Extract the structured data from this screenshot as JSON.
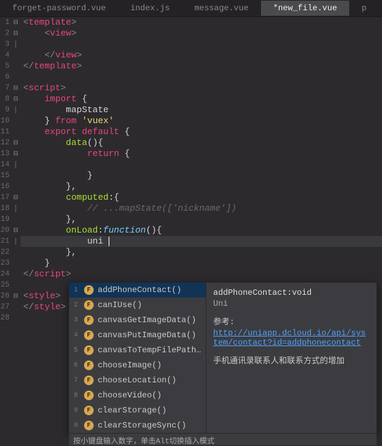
{
  "tabs": [
    {
      "label": "forget-password.vue",
      "active": false
    },
    {
      "label": "index.js",
      "active": false
    },
    {
      "label": "message.vue",
      "active": false
    },
    {
      "label": "*new_file.vue",
      "active": true
    },
    {
      "label": "p",
      "active": false
    }
  ],
  "code_lines": [
    {
      "n": 1,
      "fold": "▣",
      "tokens": [
        [
          "<",
          "p-gray"
        ],
        [
          "template",
          "p-red"
        ],
        [
          ">",
          "p-gray"
        ]
      ]
    },
    {
      "n": 2,
      "fold": "▣",
      "tokens": [
        [
          "    ",
          "p-gray"
        ],
        [
          "<",
          "p-gray"
        ],
        [
          "view",
          "p-red"
        ],
        [
          ">",
          "p-gray"
        ]
      ]
    },
    {
      "n": 3,
      "fold": "│",
      "tokens": [
        [
          "",
          "p-gray"
        ]
      ]
    },
    {
      "n": 4,
      "fold": "",
      "tokens": [
        [
          "    ",
          "p-gray"
        ],
        [
          "</",
          "p-gray"
        ],
        [
          "view",
          "p-red"
        ],
        [
          ">",
          "p-gray"
        ]
      ]
    },
    {
      "n": 5,
      "fold": "",
      "tokens": [
        [
          "</",
          "p-gray"
        ],
        [
          "template",
          "p-red"
        ],
        [
          ">",
          "p-gray"
        ]
      ]
    },
    {
      "n": 6,
      "fold": "",
      "tokens": [
        [
          "",
          "p-gray"
        ]
      ]
    },
    {
      "n": 7,
      "fold": "▣",
      "tokens": [
        [
          "<",
          "p-gray"
        ],
        [
          "script",
          "p-red"
        ],
        [
          ">",
          "p-gray"
        ]
      ]
    },
    {
      "n": 8,
      "fold": "▣",
      "tokens": [
        [
          "    ",
          "p-gray"
        ],
        [
          "import",
          "p-red"
        ],
        [
          " {",
          "p-white"
        ]
      ]
    },
    {
      "n": 9,
      "fold": "│",
      "tokens": [
        [
          "        mapState",
          "p-white"
        ]
      ]
    },
    {
      "n": 10,
      "fold": "",
      "tokens": [
        [
          "    } ",
          "p-white"
        ],
        [
          "from",
          "p-red"
        ],
        [
          " ",
          "p-white"
        ],
        [
          "'vuex'",
          "p-yellow"
        ]
      ]
    },
    {
      "n": 11,
      "fold": "",
      "tokens": [
        [
          "    ",
          "p-white"
        ],
        [
          "export",
          "p-red"
        ],
        [
          " ",
          "p-white"
        ],
        [
          "default",
          "p-red"
        ],
        [
          " {",
          "p-white"
        ]
      ]
    },
    {
      "n": 12,
      "fold": "▣",
      "tokens": [
        [
          "        ",
          "p-white"
        ],
        [
          "data",
          "p-green"
        ],
        [
          "(){",
          "p-white"
        ]
      ]
    },
    {
      "n": 13,
      "fold": "▣",
      "tokens": [
        [
          "            ",
          "p-white"
        ],
        [
          "return",
          "p-red"
        ],
        [
          " {",
          "p-white"
        ]
      ]
    },
    {
      "n": 14,
      "fold": "│",
      "tokens": [
        [
          "",
          "p-white"
        ]
      ]
    },
    {
      "n": 15,
      "fold": "",
      "tokens": [
        [
          "            }",
          "p-white"
        ]
      ]
    },
    {
      "n": 16,
      "fold": "",
      "tokens": [
        [
          "        },",
          "p-white"
        ]
      ]
    },
    {
      "n": 17,
      "fold": "▣",
      "tokens": [
        [
          "        ",
          "p-white"
        ],
        [
          "computed",
          "p-green"
        ],
        [
          ":{",
          "p-white"
        ]
      ]
    },
    {
      "n": 18,
      "fold": "│",
      "tokens": [
        [
          "            ",
          "p-white"
        ],
        [
          "// ...mapState(['nickname'])",
          "p-comment"
        ]
      ]
    },
    {
      "n": 19,
      "fold": "",
      "tokens": [
        [
          "        },",
          "p-white"
        ]
      ]
    },
    {
      "n": 20,
      "fold": "▣",
      "tokens": [
        [
          "        ",
          "p-white"
        ],
        [
          "onLoad",
          "p-green"
        ],
        [
          ":",
          "p-white"
        ],
        [
          "function",
          "p-blue p-italic"
        ],
        [
          "(){",
          "p-white"
        ]
      ]
    },
    {
      "n": 21,
      "fold": "│",
      "tokens": [
        [
          "            uni ",
          "p-white"
        ]
      ],
      "cursor": true
    },
    {
      "n": 22,
      "fold": "",
      "tokens": [
        [
          "        },",
          "p-white"
        ]
      ]
    },
    {
      "n": 23,
      "fold": "",
      "tokens": [
        [
          "    }",
          "p-white"
        ]
      ]
    },
    {
      "n": 24,
      "fold": "",
      "tokens": [
        [
          "</",
          "p-gray"
        ],
        [
          "script",
          "p-red"
        ],
        [
          ">",
          "p-gray"
        ]
      ]
    },
    {
      "n": 25,
      "fold": "",
      "tokens": [
        [
          "",
          "p-gray"
        ]
      ]
    },
    {
      "n": 26,
      "fold": "▣",
      "tokens": [
        [
          "<",
          "p-gray"
        ],
        [
          "style",
          "p-red"
        ],
        [
          ">",
          "p-gray"
        ]
      ]
    },
    {
      "n": 27,
      "fold": "",
      "tokens": [
        [
          "</",
          "p-gray"
        ],
        [
          "style",
          "p-red"
        ],
        [
          ">",
          "p-gray"
        ]
      ]
    },
    {
      "n": 28,
      "fold": "",
      "tokens": [
        [
          "",
          "p-gray"
        ]
      ]
    }
  ],
  "autocomplete": {
    "items": [
      {
        "idx": "1",
        "label": "addPhoneContact()",
        "selected": true
      },
      {
        "idx": "2",
        "label": "canIUse()"
      },
      {
        "idx": "3",
        "label": "canvasGetImageData()"
      },
      {
        "idx": "4",
        "label": "canvasPutImageData()"
      },
      {
        "idx": "5",
        "label": "canvasToTempFilePath…"
      },
      {
        "idx": "6",
        "label": "chooseImage()"
      },
      {
        "idx": "7",
        "label": "chooseLocation()"
      },
      {
        "idx": "8",
        "label": "chooseVideo()"
      },
      {
        "idx": "9",
        "label": "clearStorage()"
      },
      {
        "idx": "0",
        "label": "clearStorageSync()"
      }
    ],
    "doc": {
      "title": "addPhoneContact:void",
      "sub": "Uni",
      "ref_label": "参考:",
      "link": "http://uniapp.dcloud.io/api/system/contact?id=addphonecontact",
      "desc": "手机通讯录联系人和联系方式的增加"
    },
    "hint": "按小键盘输入数字，单击Alt切换插入模式"
  }
}
